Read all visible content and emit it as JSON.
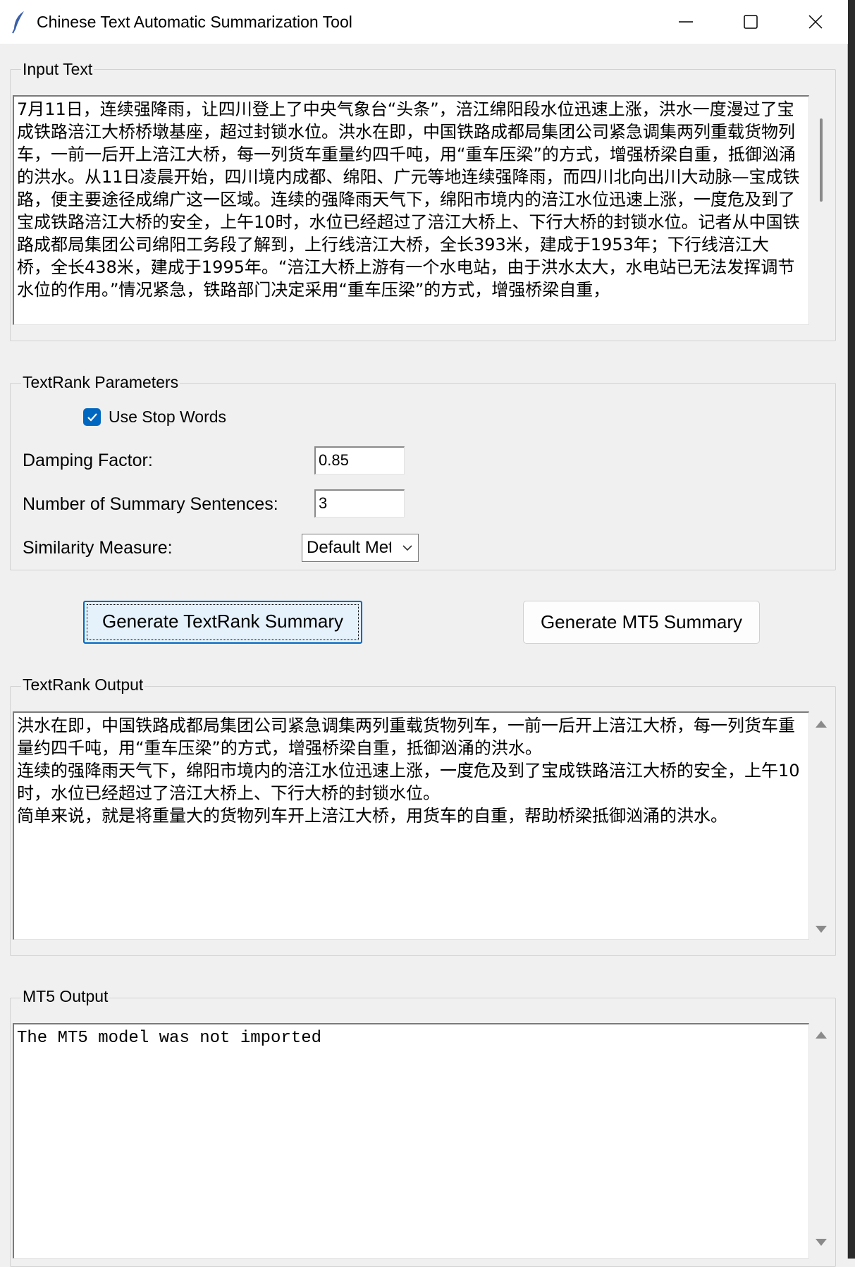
{
  "window": {
    "title": "Chinese Text Automatic Summarization Tool",
    "icon": "feather-icon"
  },
  "input_group": {
    "label": "Input Text",
    "text": "7月11日，连续强降雨，让四川登上了中央气象台“头条”，涪江绵阳段水位迅速上涨，洪水一度漫过了宝成铁路涪江大桥桥墩基座，超过封锁水位。洪水在即，中国铁路成都局集团公司紧急调集两列重载货物列车，一前一后开上涪江大桥，每一列货车重量约四千吨，用“重车压梁”的方式，增强桥梁自重，抵御汹涌的洪水。从11日凌晨开始，四川境内成都、绵阳、广元等地连续强降雨，而四川北向出川大动脉—宝成铁路，便主要途径成绵广这一区域。连续的强降雨天气下，绵阳市境内的涪江水位迅速上涨，一度危及到了宝成铁路涪江大桥的安全，上午10时，水位已经超过了涪江大桥上、下行大桥的封锁水位。记者从中国铁路成都局集团公司绵阳工务段了解到，上行线涪江大桥，全长393米，建成于1953年；下行线涪江大桥，全长438米，建成于1995年。“涪江大桥上游有一个水电站，由于洪水太大，水电站已无法发挥调节水位的作用。”情况紧急，铁路部门决定采用“重车压梁”的方式，增强桥梁自重，"
  },
  "params_group": {
    "label": "TextRank Parameters",
    "use_stop_words_label": "Use Stop Words",
    "use_stop_words_checked": true,
    "damping_label": "Damping Factor:",
    "damping_value": "0.85",
    "sentences_label": "Number of Summary Sentences:",
    "sentences_value": "3",
    "similarity_label": "Similarity Measure:",
    "similarity_value": "Default Method"
  },
  "buttons": {
    "textrank": "Generate TextRank Summary",
    "mt5": "Generate MT5 Summary"
  },
  "textrank_output": {
    "label": "TextRank Output",
    "text": "洪水在即，中国铁路成都局集团公司紧急调集两列重载货物列车，一前一后开上涪江大桥，每一列货车重量约四千吨，用“重车压梁”的方式，增强桥梁自重，抵御汹涌的洪水。\n连续的强降雨天气下，绵阳市境内的涪江水位迅速上涨，一度危及到了宝成铁路涪江大桥的安全，上午10时，水位已经超过了涪江大桥上、下行大桥的封锁水位。\n简单来说，就是将重量大的货物列车开上涪江大桥，用货车的自重，帮助桥梁抵御汹涌的洪水。"
  },
  "mt5_output": {
    "label": "MT5 Output",
    "text": "The MT5 model was not imported"
  },
  "colors": {
    "accent": "#0067c0",
    "window_bg": "#f0f0f0",
    "focused_button_bg": "#e5f1fb"
  }
}
